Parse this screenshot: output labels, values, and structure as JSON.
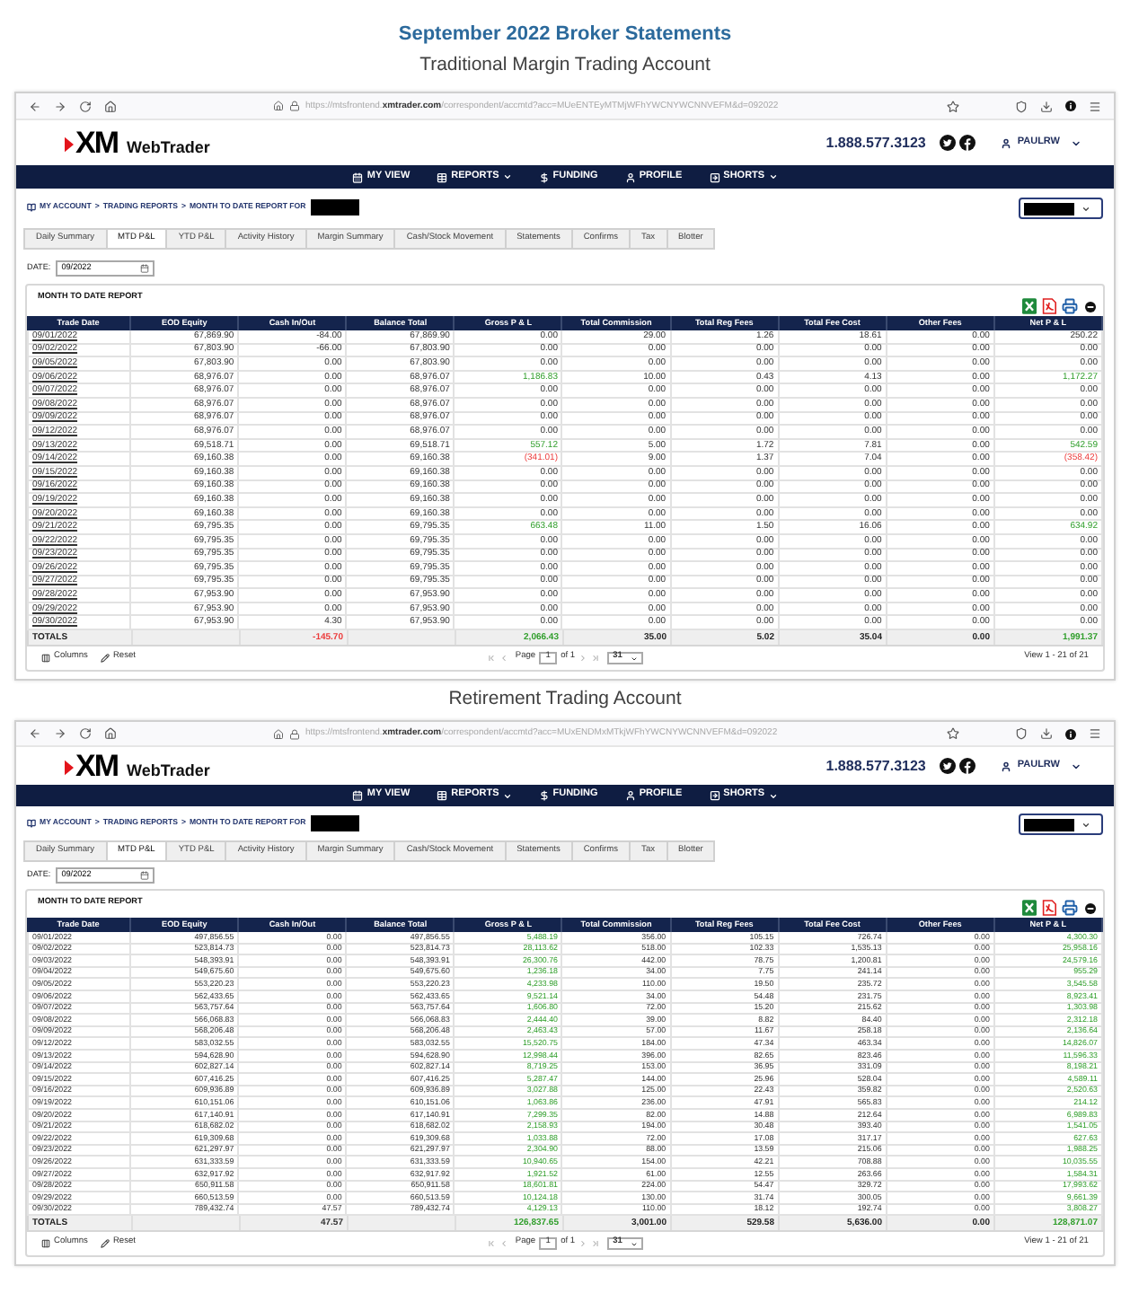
{
  "heading": "September 2022 Broker Statements",
  "accounts": [
    {
      "caption": "Traditional Margin Trading Account",
      "browser": {
        "url": "https://mtsfrontend.**xmtrader.com**/correspondent/accmtd?acc=MUeENTEyMTMjWFhYWCNYWCNNVEFM&d=092022"
      },
      "site": {
        "logo_mark": "XM",
        "logo_product": "WebTrader",
        "phone": "1.888.577.3123",
        "user": "PAULRW"
      },
      "nav": [
        {
          "label": "MY VIEW",
          "dropdown": false
        },
        {
          "label": "REPORTS",
          "dropdown": true
        },
        {
          "label": "FUNDING",
          "dropdown": false
        },
        {
          "label": "PROFILE",
          "dropdown": false
        },
        {
          "label": "SHORTS",
          "dropdown": true
        }
      ],
      "breadcrumb": {
        "items": [
          "MY ACCOUNT",
          "TRADING REPORTS",
          "MONTH TO DATE REPORT FOR"
        ],
        "separator": ">"
      },
      "tabs": [
        {
          "label": "Daily Summary",
          "selected": false
        },
        {
          "label": "MTD P&L",
          "selected": true
        },
        {
          "label": "YTD P&L",
          "selected": false
        },
        {
          "label": "Activity History",
          "selected": false
        },
        {
          "label": "Margin Summary",
          "selected": false
        },
        {
          "label": "Cash/Stock Movement",
          "selected": false
        },
        {
          "label": "Statements",
          "selected": false
        },
        {
          "label": "Confirms",
          "selected": false
        },
        {
          "label": "Tax",
          "selected": false
        },
        {
          "label": "Blotter",
          "selected": false
        }
      ],
      "date": {
        "label": "DATE:",
        "value": "09/2022"
      },
      "report": {
        "title": "MONTH TO DATE REPORT",
        "dates_underlined": true,
        "columns": [
          "Trade Date",
          "EOD Equity",
          "Cash In/Out",
          "Balance Total",
          "Gross P & L",
          "Total Commission",
          "Total Reg Fees",
          "Total Fee Cost",
          "Other Fees",
          "Net P & L"
        ],
        "rows": [
          {
            "cells": [
              "09/01/2022",
              "67,869.90",
              "-84.00",
              "67,869.90",
              "0.00",
              "29.00",
              "1.26",
              "18.61",
              "0.00",
              "250.22"
            ],
            "profit": false,
            "loss": false
          },
          {
            "cells": [
              "09/02/2022",
              "67,803.90",
              "-66.00",
              "67,803.90",
              "0.00",
              "0.00",
              "0.00",
              "0.00",
              "0.00",
              "0.00"
            ],
            "profit": false,
            "loss": false
          },
          {
            "cells": [
              "09/05/2022",
              "67,803.90",
              "0.00",
              "67,803.90",
              "0.00",
              "0.00",
              "0.00",
              "0.00",
              "0.00",
              "0.00"
            ],
            "profit": false,
            "loss": false
          },
          {
            "cells": [
              "09/06/2022",
              "68,976.07",
              "0.00",
              "68,976.07",
              "1,186.83",
              "10.00",
              "0.43",
              "4.13",
              "0.00",
              "1,172.27"
            ],
            "profit": true,
            "loss": false
          },
          {
            "cells": [
              "09/07/2022",
              "68,976.07",
              "0.00",
              "68,976.07",
              "0.00",
              "0.00",
              "0.00",
              "0.00",
              "0.00",
              "0.00"
            ],
            "profit": false,
            "loss": false
          },
          {
            "cells": [
              "09/08/2022",
              "68,976.07",
              "0.00",
              "68,976.07",
              "0.00",
              "0.00",
              "0.00",
              "0.00",
              "0.00",
              "0.00"
            ],
            "profit": false,
            "loss": false
          },
          {
            "cells": [
              "09/09/2022",
              "68,976.07",
              "0.00",
              "68,976.07",
              "0.00",
              "0.00",
              "0.00",
              "0.00",
              "0.00",
              "0.00"
            ],
            "profit": false,
            "loss": false
          },
          {
            "cells": [
              "09/12/2022",
              "68,976.07",
              "0.00",
              "68,976.07",
              "0.00",
              "0.00",
              "0.00",
              "0.00",
              "0.00",
              "0.00"
            ],
            "profit": false,
            "loss": false
          },
          {
            "cells": [
              "09/13/2022",
              "69,518.71",
              "0.00",
              "69,518.71",
              "557.12",
              "5.00",
              "1.72",
              "7.81",
              "0.00",
              "542.59"
            ],
            "profit": true,
            "loss": false
          },
          {
            "cells": [
              "09/14/2022",
              "69,160.38",
              "0.00",
              "69,160.38",
              "(341.01)",
              "9.00",
              "1.37",
              "7.04",
              "0.00",
              "(358.42)"
            ],
            "profit": false,
            "loss": true
          },
          {
            "cells": [
              "09/15/2022",
              "69,160.38",
              "0.00",
              "69,160.38",
              "0.00",
              "0.00",
              "0.00",
              "0.00",
              "0.00",
              "0.00"
            ],
            "profit": false,
            "loss": false
          },
          {
            "cells": [
              "09/16/2022",
              "69,160.38",
              "0.00",
              "69,160.38",
              "0.00",
              "0.00",
              "0.00",
              "0.00",
              "0.00",
              "0.00"
            ],
            "profit": false,
            "loss": false
          },
          {
            "cells": [
              "09/19/2022",
              "69,160.38",
              "0.00",
              "69,160.38",
              "0.00",
              "0.00",
              "0.00",
              "0.00",
              "0.00",
              "0.00"
            ],
            "profit": false,
            "loss": false
          },
          {
            "cells": [
              "09/20/2022",
              "69,160.38",
              "0.00",
              "69,160.38",
              "0.00",
              "0.00",
              "0.00",
              "0.00",
              "0.00",
              "0.00"
            ],
            "profit": false,
            "loss": false
          },
          {
            "cells": [
              "09/21/2022",
              "69,795.35",
              "0.00",
              "69,795.35",
              "663.48",
              "11.00",
              "1.50",
              "16.06",
              "0.00",
              "634.92"
            ],
            "profit": true,
            "loss": false
          },
          {
            "cells": [
              "09/22/2022",
              "69,795.35",
              "0.00",
              "69,795.35",
              "0.00",
              "0.00",
              "0.00",
              "0.00",
              "0.00",
              "0.00"
            ],
            "profit": false,
            "loss": false
          },
          {
            "cells": [
              "09/23/2022",
              "69,795.35",
              "0.00",
              "69,795.35",
              "0.00",
              "0.00",
              "0.00",
              "0.00",
              "0.00",
              "0.00"
            ],
            "profit": false,
            "loss": false
          },
          {
            "cells": [
              "09/26/2022",
              "69,795.35",
              "0.00",
              "69,795.35",
              "0.00",
              "0.00",
              "0.00",
              "0.00",
              "0.00",
              "0.00"
            ],
            "profit": false,
            "loss": false
          },
          {
            "cells": [
              "09/27/2022",
              "69,795.35",
              "0.00",
              "69,795.35",
              "0.00",
              "0.00",
              "0.00",
              "0.00",
              "0.00",
              "0.00"
            ],
            "profit": false,
            "loss": false
          },
          {
            "cells": [
              "09/28/2022",
              "67,953.90",
              "0.00",
              "67,953.90",
              "0.00",
              "0.00",
              "0.00",
              "0.00",
              "0.00",
              "0.00"
            ],
            "profit": false,
            "loss": false
          },
          {
            "cells": [
              "09/29/2022",
              "67,953.90",
              "0.00",
              "67,953.90",
              "0.00",
              "0.00",
              "0.00",
              "0.00",
              "0.00",
              "0.00"
            ],
            "profit": false,
            "loss": false
          },
          {
            "cells": [
              "09/30/2022",
              "67,953.90",
              "4.30",
              "67,953.90",
              "0.00",
              "0.00",
              "0.00",
              "0.00",
              "0.00",
              "0.00"
            ],
            "profit": false,
            "loss": false
          }
        ],
        "totals": {
          "label": "TOTALS",
          "cash_in_out": "-145.70",
          "gross_pl": "2,066.43",
          "total_commission": "35.00",
          "total_reg_fees": "5.02",
          "total_fee_cost": "35.04",
          "other_fees": "0.00",
          "net_pl": "1,991.37",
          "cash_loss": true,
          "pl_profit": true
        },
        "footer": {
          "columns": "Columns",
          "reset": "Reset",
          "page_label": "Page",
          "page": "1",
          "page_of": "of 1",
          "page_size": "31",
          "view": "View 1 - 21 of 21"
        }
      }
    },
    {
      "caption": "Retirement Trading Account",
      "browser": {
        "url": "https://mtsfrontend.**xmtrader.com**/correspondent/accmtd?acc=MUxENDMxMTkjWFhYWCNYWCNNVEFM&d=092022"
      },
      "site": {
        "logo_mark": "XM",
        "logo_product": "WebTrader",
        "phone": "1.888.577.3123",
        "user": "PAULRW"
      },
      "nav": [
        {
          "label": "MY VIEW",
          "dropdown": false
        },
        {
          "label": "REPORTS",
          "dropdown": true
        },
        {
          "label": "FUNDING",
          "dropdown": false
        },
        {
          "label": "PROFILE",
          "dropdown": false
        },
        {
          "label": "SHORTS",
          "dropdown": true
        }
      ],
      "breadcrumb": {
        "items": [
          "MY ACCOUNT",
          "TRADING REPORTS",
          "MONTH TO DATE REPORT FOR"
        ],
        "separator": ">"
      },
      "tabs": [
        {
          "label": "Daily Summary",
          "selected": false
        },
        {
          "label": "MTD P&L",
          "selected": true
        },
        {
          "label": "YTD P&L",
          "selected": false
        },
        {
          "label": "Activity History",
          "selected": false
        },
        {
          "label": "Margin Summary",
          "selected": false
        },
        {
          "label": "Cash/Stock Movement",
          "selected": false
        },
        {
          "label": "Statements",
          "selected": false
        },
        {
          "label": "Confirms",
          "selected": false
        },
        {
          "label": "Tax",
          "selected": false
        },
        {
          "label": "Blotter",
          "selected": false
        }
      ],
      "date": {
        "label": "DATE:",
        "value": "09/2022"
      },
      "report": {
        "title": "MONTH TO DATE REPORT",
        "dates_underlined": false,
        "columns": [
          "Trade Date",
          "EOD Equity",
          "Cash In/Out",
          "Balance Total",
          "Gross P & L",
          "Total Commission",
          "Total Reg Fees",
          "Total Fee Cost",
          "Other Fees",
          "Net P & L"
        ],
        "rows": [
          {
            "cells": [
              "09/01/2022",
              "497,856.55",
              "0.00",
              "497,856.55",
              "5,488.19",
              "356.00",
              "105.15",
              "726.74",
              "0.00",
              "4,300.30"
            ],
            "profit": true,
            "loss": false
          },
          {
            "cells": [
              "09/02/2022",
              "523,814.73",
              "0.00",
              "523,814.73",
              "28,113.62",
              "518.00",
              "102.33",
              "1,535.13",
              "0.00",
              "25,958.16"
            ],
            "profit": true,
            "loss": false
          },
          {
            "cells": [
              "09/03/2022",
              "548,393.91",
              "0.00",
              "548,393.91",
              "26,300.76",
              "442.00",
              "78.75",
              "1,200.81",
              "0.00",
              "24,579.16"
            ],
            "profit": true,
            "loss": false
          },
          {
            "cells": [
              "09/04/2022",
              "549,675.60",
              "0.00",
              "549,675.60",
              "1,236.18",
              "34.00",
              "7.75",
              "241.14",
              "0.00",
              "955.29"
            ],
            "profit": true,
            "loss": false
          },
          {
            "cells": [
              "09/05/2022",
              "553,220.23",
              "0.00",
              "553,220.23",
              "4,233.98",
              "110.00",
              "19.50",
              "235.72",
              "0.00",
              "3,545.58"
            ],
            "profit": true,
            "loss": false
          },
          {
            "cells": [
              "09/06/2022",
              "562,433.65",
              "0.00",
              "562,433.65",
              "9,521.14",
              "34.00",
              "54.48",
              "231.75",
              "0.00",
              "8,923.41"
            ],
            "profit": true,
            "loss": false
          },
          {
            "cells": [
              "09/07/2022",
              "563,757.64",
              "0.00",
              "563,757.64",
              "1,606.80",
              "72.00",
              "15.20",
              "215.62",
              "0.00",
              "1,303.98"
            ],
            "profit": true,
            "loss": false
          },
          {
            "cells": [
              "09/08/2022",
              "566,068.83",
              "0.00",
              "566,068.83",
              "2,444.40",
              "39.00",
              "8.82",
              "84.40",
              "0.00",
              "2,312.18"
            ],
            "profit": true,
            "loss": false
          },
          {
            "cells": [
              "09/09/2022",
              "568,206.48",
              "0.00",
              "568,206.48",
              "2,463.43",
              "57.00",
              "11.67",
              "258.18",
              "0.00",
              "2,136.64"
            ],
            "profit": true,
            "loss": false
          },
          {
            "cells": [
              "09/12/2022",
              "583,032.55",
              "0.00",
              "583,032.55",
              "15,520.75",
              "184.00",
              "47.34",
              "463.34",
              "0.00",
              "14,826.07"
            ],
            "profit": true,
            "loss": false
          },
          {
            "cells": [
              "09/13/2022",
              "594,628.90",
              "0.00",
              "594,628.90",
              "12,998.44",
              "396.00",
              "82.65",
              "823.46",
              "0.00",
              "11,596.33"
            ],
            "profit": true,
            "loss": false
          },
          {
            "cells": [
              "09/14/2022",
              "602,827.14",
              "0.00",
              "602,827.14",
              "8,719.25",
              "153.00",
              "36.95",
              "331.09",
              "0.00",
              "8,198.21"
            ],
            "profit": true,
            "loss": false
          },
          {
            "cells": [
              "09/15/2022",
              "607,416.25",
              "0.00",
              "607,416.25",
              "5,287.47",
              "144.00",
              "25.96",
              "528.04",
              "0.00",
              "4,589.11"
            ],
            "profit": true,
            "loss": false
          },
          {
            "cells": [
              "09/16/2022",
              "609,936.89",
              "0.00",
              "609,936.89",
              "3,027.88",
              "125.00",
              "22.43",
              "359.82",
              "0.00",
              "2,520.63"
            ],
            "profit": true,
            "loss": false
          },
          {
            "cells": [
              "09/19/2022",
              "610,151.06",
              "0.00",
              "610,151.06",
              "1,063.86",
              "236.00",
              "47.91",
              "565.83",
              "0.00",
              "214.12"
            ],
            "profit": true,
            "loss": false
          },
          {
            "cells": [
              "09/20/2022",
              "617,140.91",
              "0.00",
              "617,140.91",
              "7,299.35",
              "82.00",
              "14.88",
              "212.64",
              "0.00",
              "6,989.83"
            ],
            "profit": true,
            "loss": false
          },
          {
            "cells": [
              "09/21/2022",
              "618,682.02",
              "0.00",
              "618,682.02",
              "2,158.93",
              "194.00",
              "30.48",
              "393.40",
              "0.00",
              "1,541.05"
            ],
            "profit": true,
            "loss": false
          },
          {
            "cells": [
              "09/22/2022",
              "619,309.68",
              "0.00",
              "619,309.68",
              "1,033.88",
              "72.00",
              "17.08",
              "317.17",
              "0.00",
              "627.63"
            ],
            "profit": true,
            "loss": false
          },
          {
            "cells": [
              "09/23/2022",
              "621,297.97",
              "0.00",
              "621,297.97",
              "2,304.90",
              "88.00",
              "13.59",
              "215.06",
              "0.00",
              "1,988.25"
            ],
            "profit": true,
            "loss": false
          },
          {
            "cells": [
              "09/26/2022",
              "631,333.59",
              "0.00",
              "631,333.59",
              "10,940.65",
              "154.00",
              "42.21",
              "708.88",
              "0.00",
              "10,035.55"
            ],
            "profit": true,
            "loss": false
          },
          {
            "cells": [
              "09/27/2022",
              "632,917.92",
              "0.00",
              "632,917.92",
              "1,921.52",
              "61.00",
              "12.55",
              "263.66",
              "0.00",
              "1,584.31"
            ],
            "profit": true,
            "loss": false
          },
          {
            "cells": [
              "09/28/2022",
              "650,911.58",
              "0.00",
              "650,911.58",
              "18,601.81",
              "224.00",
              "54.47",
              "329.72",
              "0.00",
              "17,993.62"
            ],
            "profit": true,
            "loss": false
          },
          {
            "cells": [
              "09/29/2022",
              "660,513.59",
              "0.00",
              "660,513.59",
              "10,124.18",
              "130.00",
              "31.74",
              "300.05",
              "0.00",
              "9,661.39"
            ],
            "profit": true,
            "loss": false
          },
          {
            "cells": [
              "09/30/2022",
              "789,432.74",
              "47.57",
              "789,432.74",
              "4,129.13",
              "110.00",
              "18.12",
              "192.74",
              "0.00",
              "3,808.27"
            ],
            "profit": true,
            "loss": false
          }
        ],
        "totals": {
          "label": "TOTALS",
          "cash_in_out": "47.57",
          "gross_pl": "126,837.65",
          "total_commission": "3,001.00",
          "total_reg_fees": "529.58",
          "total_fee_cost": "5,636.00",
          "other_fees": "0.00",
          "net_pl": "128,871.07",
          "cash_loss": false,
          "pl_profit": true
        },
        "footer": {
          "columns": "Columns",
          "reset": "Reset",
          "page_label": "Page",
          "page": "1",
          "page_of": "of 1",
          "page_size": "31",
          "view": "View 1 - 21 of 21"
        }
      }
    }
  ]
}
